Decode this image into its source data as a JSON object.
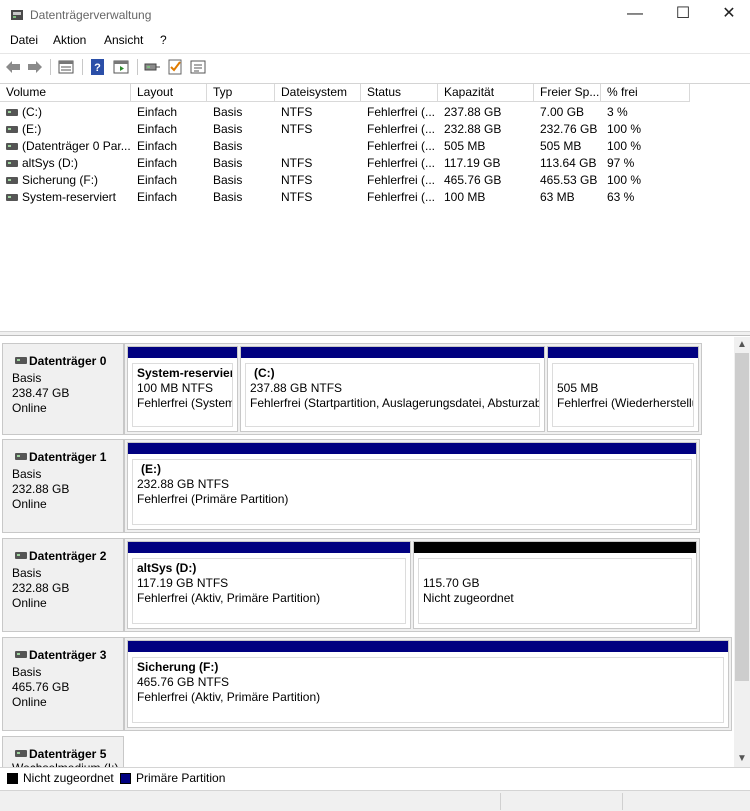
{
  "window": {
    "title": "Datenträgerverwaltung",
    "min_glyph": "—",
    "max_glyph": "☐",
    "close_glyph": "✕"
  },
  "menu": [
    "Datei",
    "Aktion",
    "Ansicht",
    "?"
  ],
  "toolbar_icons": [
    "back-arrow-icon",
    "forward-arrow-icon",
    "list-view-icon",
    "help-icon",
    "console-icon",
    "connect-icon",
    "check-icon",
    "properties-icon"
  ],
  "volume_table": {
    "columns": [
      "Volume",
      "Layout",
      "Typ",
      "Dateisystem",
      "Status",
      "Kapazität",
      "Freier Sp...",
      "% frei"
    ],
    "rows": [
      [
        "(C:)",
        "Einfach",
        "Basis",
        "NTFS",
        "Fehlerfrei (...",
        "237.88 GB",
        "7.00 GB",
        "3 %"
      ],
      [
        "(E:)",
        "Einfach",
        "Basis",
        "NTFS",
        "Fehlerfrei (...",
        "232.88 GB",
        "232.76 GB",
        "100 %"
      ],
      [
        "(Datenträger 0 Par...",
        "Einfach",
        "Basis",
        "",
        "Fehlerfrei (...",
        "505 MB",
        "505 MB",
        "100 %"
      ],
      [
        "altSys (D:)",
        "Einfach",
        "Basis",
        "NTFS",
        "Fehlerfrei (...",
        "117.19 GB",
        "113.64 GB",
        "97 %"
      ],
      [
        "Sicherung (F:)",
        "Einfach",
        "Basis",
        "NTFS",
        "Fehlerfrei (...",
        "465.76 GB",
        "465.53 GB",
        "100 %"
      ],
      [
        "System-reserviert",
        "Einfach",
        "Basis",
        "NTFS",
        "Fehlerfrei (...",
        "100 MB",
        "63 MB",
        "63 %"
      ]
    ]
  },
  "disks": [
    {
      "name": "Datenträger 0",
      "type": "Basis",
      "size": "238.47 GB",
      "status": "Online",
      "partitions": [
        {
          "kind": "primary",
          "name": "System-reservier",
          "size": "100 MB NTFS",
          "status": "Fehlerfrei (System,"
        },
        {
          "kind": "primary",
          "name": "(C:)",
          "size": "237.88 GB NTFS",
          "status": "Fehlerfrei (Startpartition, Auslagerungsdatei, Absturzabl"
        },
        {
          "kind": "primary",
          "name": "",
          "size": "505 MB",
          "status": "Fehlerfrei (Wiederherstellu"
        }
      ]
    },
    {
      "name": "Datenträger 1",
      "type": "Basis",
      "size": "232.88 GB",
      "status": "Online",
      "partitions": [
        {
          "kind": "primary",
          "name": "(E:)",
          "size": "232.88 GB NTFS",
          "status": "Fehlerfrei (Primäre Partition)"
        }
      ]
    },
    {
      "name": "Datenträger 2",
      "type": "Basis",
      "size": "232.88 GB",
      "status": "Online",
      "partitions": [
        {
          "kind": "primary",
          "name": "altSys  (D:)",
          "size": "117.19 GB NTFS",
          "status": "Fehlerfrei (Aktiv, Primäre Partition)"
        },
        {
          "kind": "unallocated",
          "name": "",
          "size": "115.70 GB",
          "status": "Nicht zugeordnet"
        }
      ]
    },
    {
      "name": "Datenträger 3",
      "type": "Basis",
      "size": "465.76 GB",
      "status": "Online",
      "partitions": [
        {
          "kind": "primary",
          "name": "Sicherung  (F:)",
          "size": "465.76 GB NTFS",
          "status": "Fehlerfrei (Aktiv, Primäre Partition)"
        }
      ]
    },
    {
      "name": "Datenträger 5",
      "type": "Wechselmedium (I:)",
      "size": "",
      "status": "",
      "partitions": []
    }
  ],
  "legend": {
    "unallocated": {
      "label": "Nicht zugeordnet",
      "color": "#000000"
    },
    "primary": {
      "label": "Primäre Partition",
      "color": "#000080"
    }
  },
  "scroll": {
    "up": "▲",
    "down": "▼"
  },
  "colors": {
    "primary_bar": "#000080",
    "unallocated_bar": "#000000"
  }
}
